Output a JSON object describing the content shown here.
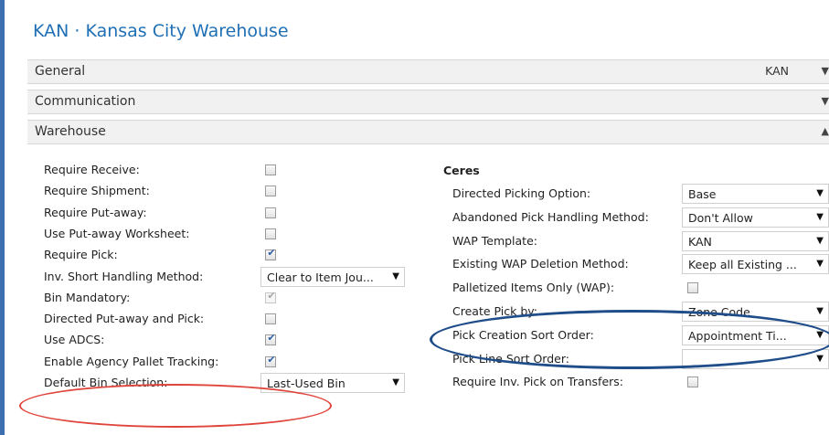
{
  "page": {
    "title": "KAN · Kansas City Warehouse"
  },
  "fasttabs": {
    "general": {
      "label": "General",
      "value": "KAN"
    },
    "communication": {
      "label": "Communication"
    },
    "warehouse": {
      "label": "Warehouse"
    }
  },
  "warehouse_left": [
    {
      "label": "Require Receive:",
      "type": "checkbox",
      "checked": false
    },
    {
      "label": "Require Shipment:",
      "type": "checkbox",
      "checked": false
    },
    {
      "label": "Require Put-away:",
      "type": "checkbox",
      "checked": false
    },
    {
      "label": "Use Put-away Worksheet:",
      "type": "checkbox",
      "checked": false
    },
    {
      "label": "Require Pick:",
      "type": "checkbox",
      "checked": true
    },
    {
      "label": "Inv. Short Handling Method:",
      "type": "select",
      "value": "Clear to Item Jou..."
    },
    {
      "label": "Bin Mandatory:",
      "type": "checkbox",
      "checked": true,
      "disabled": true
    },
    {
      "label": "Directed Put-away and Pick:",
      "type": "checkbox",
      "checked": false
    },
    {
      "label": "Use ADCS:",
      "type": "checkbox",
      "checked": true
    },
    {
      "label": "Enable Agency Pallet Tracking:",
      "type": "checkbox",
      "checked": true
    },
    {
      "label": "Default Bin Selection:",
      "type": "select",
      "value": "Last-Used Bin"
    }
  ],
  "ceres": {
    "heading": "Ceres",
    "fields": [
      {
        "label": "Directed Picking Option:",
        "type": "select",
        "value": "Base"
      },
      {
        "label": "Abandoned Pick Handling Method:",
        "type": "select",
        "value": "Don't Allow"
      },
      {
        "label": "WAP Template:",
        "type": "select",
        "value": "KAN"
      },
      {
        "label": "Existing WAP Deletion Method:",
        "type": "select",
        "value": "Keep all Existing ..."
      },
      {
        "label": "Palletized Items Only (WAP):",
        "type": "checkbox",
        "checked": false
      },
      {
        "label": "Create Pick by:",
        "type": "select",
        "value": "Zone Code"
      },
      {
        "label": "Pick Creation Sort Order:",
        "type": "select",
        "value": "Appointment Ti..."
      },
      {
        "label": "Pick Line Sort Order:",
        "type": "select",
        "value": ""
      },
      {
        "label": "Require Inv. Pick on Transfers:",
        "type": "checkbox",
        "checked": false
      }
    ]
  },
  "colors": {
    "title_blue": "#1f6fb5",
    "highlight_red": "#e0453c",
    "highlight_blue": "#1f4d8a",
    "check_blue": "#2f5fa5"
  }
}
